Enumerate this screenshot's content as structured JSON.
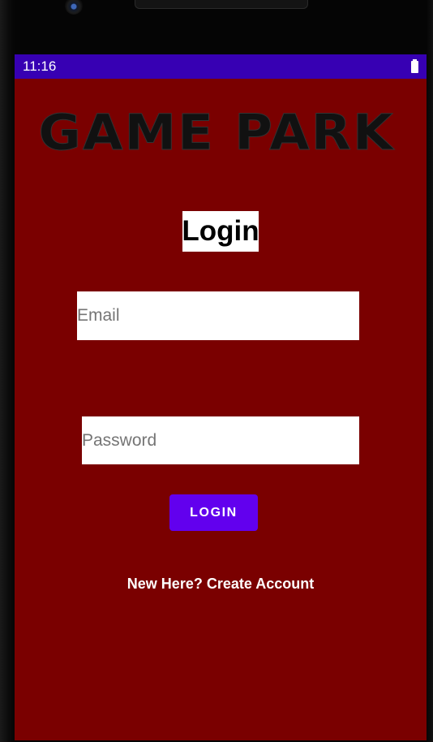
{
  "status_bar": {
    "time": "11:16",
    "battery_icon": "battery-full-icon"
  },
  "app": {
    "logo_text": "GAME PARK",
    "title": "Login"
  },
  "form": {
    "email_placeholder": "Email",
    "password_placeholder": "Password",
    "login_label": "LOGIN",
    "create_account_label": "New Here? Create Account"
  },
  "colors": {
    "status_bar": "#3700b3",
    "background": "#7a0000",
    "button": "#6200ee"
  }
}
